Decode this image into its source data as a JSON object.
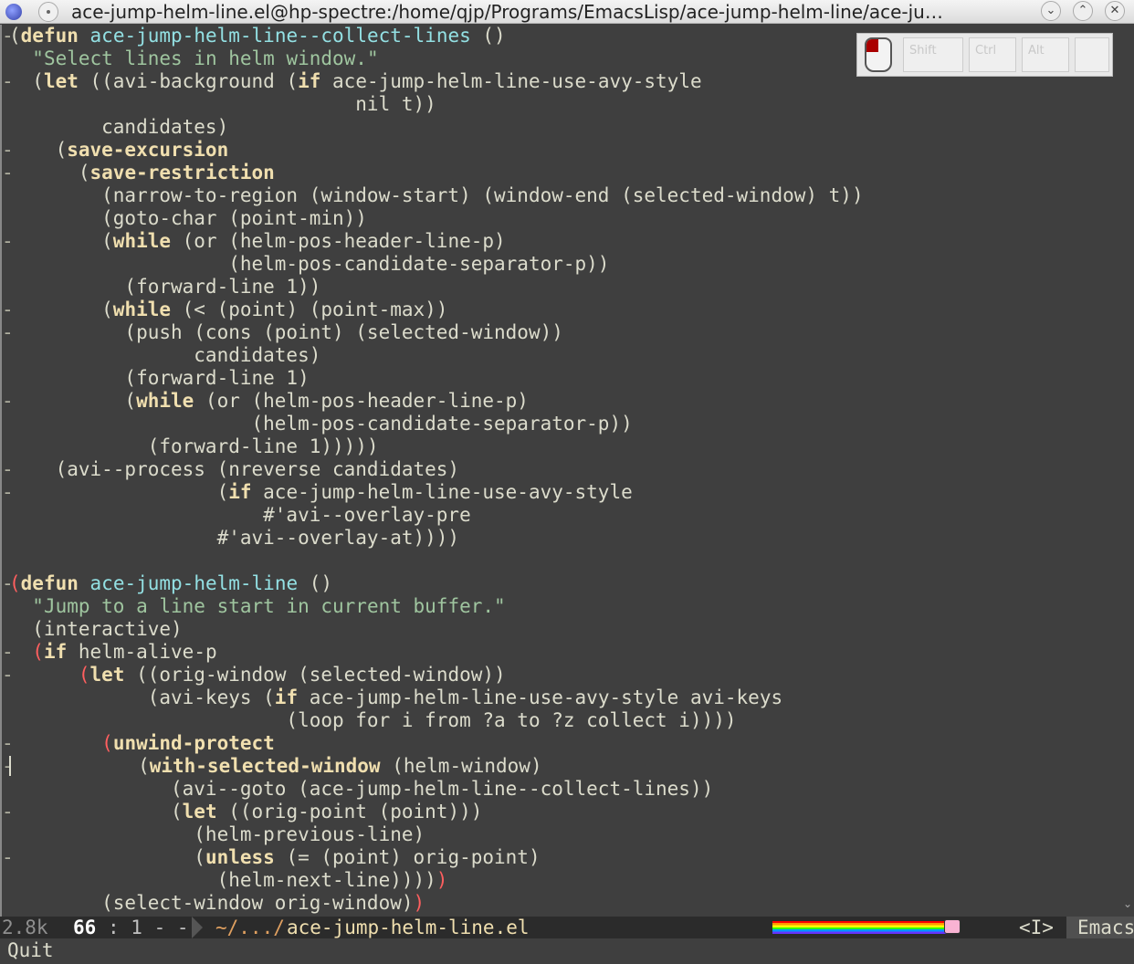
{
  "window": {
    "title": "ace-jump-helm-line.el@hp-spectre:/home/qjp/Programs/EmacsLisp/ace-jump-helm-line/ace-ju…",
    "buttons": {
      "minimize": "⌄",
      "maximize": "⌃",
      "close": "✕"
    }
  },
  "key_overlay": {
    "keys": [
      "Shift",
      "Ctrl",
      "Alt",
      ""
    ]
  },
  "code_lines": [
    [
      {
        "t": "("
      },
      {
        "t": "defun",
        "c": "kw"
      },
      {
        "t": " "
      },
      {
        "t": "ace-jump-helm-line--collect-lines",
        "c": "fn"
      },
      {
        "t": " ()"
      }
    ],
    [
      {
        "t": "  "
      },
      {
        "t": "\"Select lines in helm window.\"",
        "c": "doc"
      }
    ],
    [
      {
        "t": "  ("
      },
      {
        "t": "let",
        "c": "kw"
      },
      {
        "t": " ((avi-background ("
      },
      {
        "t": "if",
        "c": "kw"
      },
      {
        "t": " ace-jump-helm-line-use-avy-style"
      }
    ],
    [
      {
        "t": "                              nil t))"
      }
    ],
    [
      {
        "t": "        candidates)"
      }
    ],
    [
      {
        "t": "    ("
      },
      {
        "t": "save-excursion",
        "c": "kw"
      }
    ],
    [
      {
        "t": "      ("
      },
      {
        "t": "save-restriction",
        "c": "kw"
      }
    ],
    [
      {
        "t": "        (narrow-to-region (window-start) (window-end (selected-window) t))"
      }
    ],
    [
      {
        "t": "        (goto-char (point-min))"
      }
    ],
    [
      {
        "t": "        ("
      },
      {
        "t": "while",
        "c": "kw"
      },
      {
        "t": " (or (helm-pos-header-line-p)"
      }
    ],
    [
      {
        "t": "                   (helm-pos-candidate-separator-p))"
      }
    ],
    [
      {
        "t": "          (forward-line 1))"
      }
    ],
    [
      {
        "t": "        ("
      },
      {
        "t": "while",
        "c": "kw"
      },
      {
        "t": " (< (point) (point-max))"
      }
    ],
    [
      {
        "t": "          (push (cons (point) (selected-window))"
      }
    ],
    [
      {
        "t": "                candidates)"
      }
    ],
    [
      {
        "t": "          (forward-line 1)"
      }
    ],
    [
      {
        "t": "          ("
      },
      {
        "t": "while",
        "c": "kw"
      },
      {
        "t": " (or (helm-pos-header-line-p)"
      }
    ],
    [
      {
        "t": "                     (helm-pos-candidate-separator-p))"
      }
    ],
    [
      {
        "t": "            (forward-line 1)))))"
      }
    ],
    [
      {
        "t": "    (avi--process (nreverse candidates)"
      }
    ],
    [
      {
        "t": "                  ("
      },
      {
        "t": "if",
        "c": "kw"
      },
      {
        "t": " ace-jump-helm-line-use-avy-style"
      }
    ],
    [
      {
        "t": "                      #'avi--overlay-pre"
      }
    ],
    [
      {
        "t": "                  #'avi--overlay-at))))"
      }
    ],
    [
      {
        "t": ""
      }
    ],
    [
      {
        "t": "(",
        "c": "rp"
      },
      {
        "t": "defun",
        "c": "kw"
      },
      {
        "t": " "
      },
      {
        "t": "ace-jump-helm-line",
        "c": "fn"
      },
      {
        "t": " ()"
      }
    ],
    [
      {
        "t": "  "
      },
      {
        "t": "\"Jump to a line start in current buffer.\"",
        "c": "doc"
      }
    ],
    [
      {
        "t": "  (interactive)"
      }
    ],
    [
      {
        "t": "  "
      },
      {
        "t": "(",
        "c": "rp"
      },
      {
        "t": "if",
        "c": "kw"
      },
      {
        "t": " helm-alive-p"
      }
    ],
    [
      {
        "t": "      "
      },
      {
        "t": "(",
        "c": "rp"
      },
      {
        "t": "let",
        "c": "kw"
      },
      {
        "t": " ((orig-window (selected-window))"
      }
    ],
    [
      {
        "t": "            (avi-keys ("
      },
      {
        "t": "if",
        "c": "kw"
      },
      {
        "t": " ace-jump-helm-line-use-avy-style avi-keys"
      }
    ],
    [
      {
        "t": "                        (loop for i from ?a to ?z collect i))))"
      }
    ],
    [
      {
        "t": "        "
      },
      {
        "t": "(",
        "c": "rp"
      },
      {
        "t": "unwind-protect",
        "c": "kw"
      }
    ],
    [
      {
        "t": "CURSOR"
      },
      {
        "t": "           ("
      },
      {
        "t": "with-selected-window",
        "c": "kw"
      },
      {
        "t": " (helm-window)"
      }
    ],
    [
      {
        "t": "              (avi--goto (ace-jump-helm-line--collect-lines))"
      }
    ],
    [
      {
        "t": "              ("
      },
      {
        "t": "let",
        "c": "kw"
      },
      {
        "t": " ((orig-point (point)))"
      }
    ],
    [
      {
        "t": "                (helm-previous-line)"
      }
    ],
    [
      {
        "t": "                ("
      },
      {
        "t": "unless",
        "c": "kw"
      },
      {
        "t": " (= (point) orig-point)"
      }
    ],
    [
      {
        "t": "                  (helm-next-line))))"
      },
      {
        "t": ")",
        "c": "rp"
      }
    ],
    [
      {
        "t": "        (select-window orig-window)"
      },
      {
        "t": ")",
        "c": "rp"
      }
    ]
  ],
  "fringe_marks": [
    1,
    0,
    1,
    0,
    0,
    1,
    1,
    0,
    0,
    1,
    0,
    0,
    1,
    1,
    0,
    0,
    1,
    0,
    0,
    1,
    1,
    0,
    0,
    0,
    1,
    0,
    0,
    1,
    1,
    0,
    0,
    1,
    1,
    0,
    1,
    0,
    1,
    0,
    0
  ],
  "modeline": {
    "size": "2.8k",
    "line": "66",
    "col": ": 1 - -",
    "dir": "~/.../",
    "file": "ace-jump-helm-line.el",
    "state": "<I>",
    "mode": "Emacs"
  },
  "echo": "Quit"
}
